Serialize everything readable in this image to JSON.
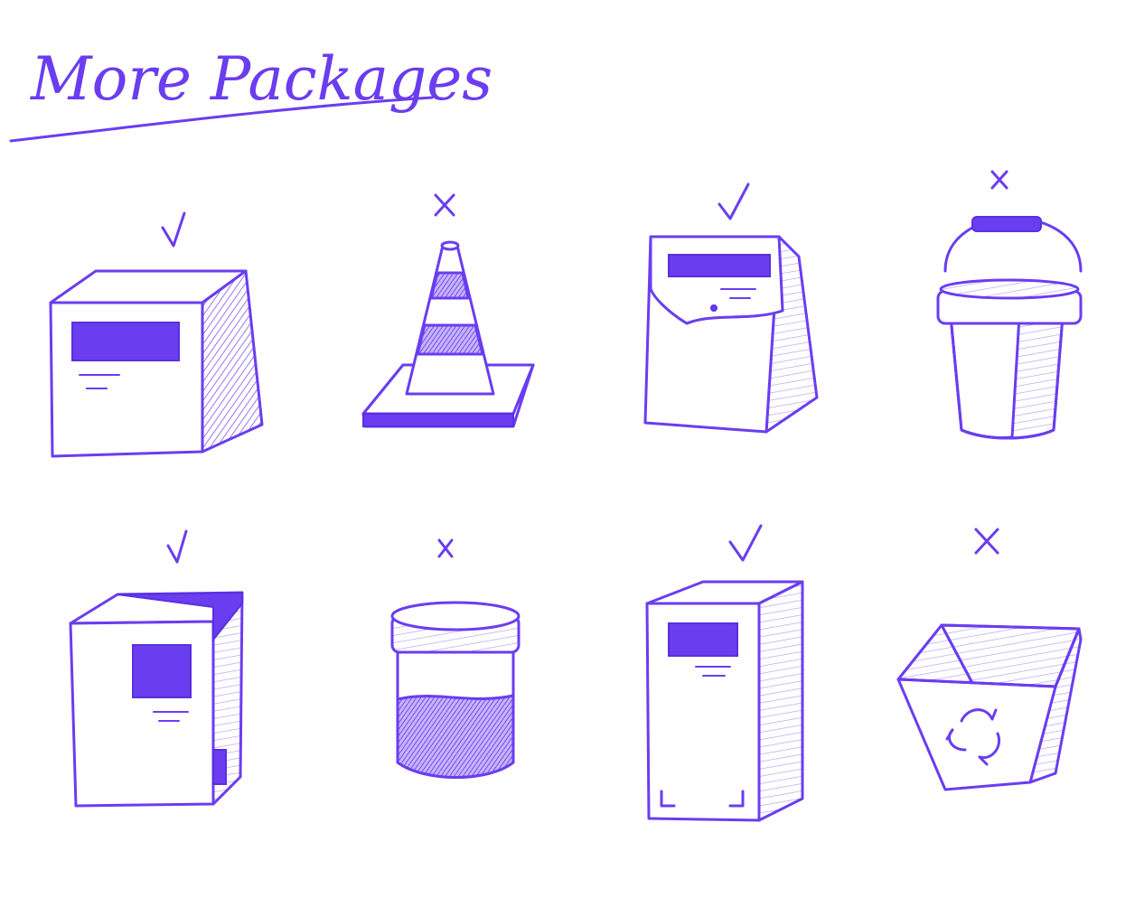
{
  "title": "More Packages",
  "colors": {
    "ink": "#6a3df0",
    "paper": "#ffffff"
  },
  "items": [
    {
      "icon": "cardboard-box-icon",
      "verdict": "check"
    },
    {
      "icon": "traffic-cone-icon",
      "verdict": "cross"
    },
    {
      "icon": "paper-bag-icon",
      "verdict": "check"
    },
    {
      "icon": "bucket-icon",
      "verdict": "cross"
    },
    {
      "icon": "taped-box-icon",
      "verdict": "check"
    },
    {
      "icon": "jar-icon",
      "verdict": "cross"
    },
    {
      "icon": "carton-box-icon",
      "verdict": "check"
    },
    {
      "icon": "recycling-bin-icon",
      "verdict": "cross"
    }
  ]
}
